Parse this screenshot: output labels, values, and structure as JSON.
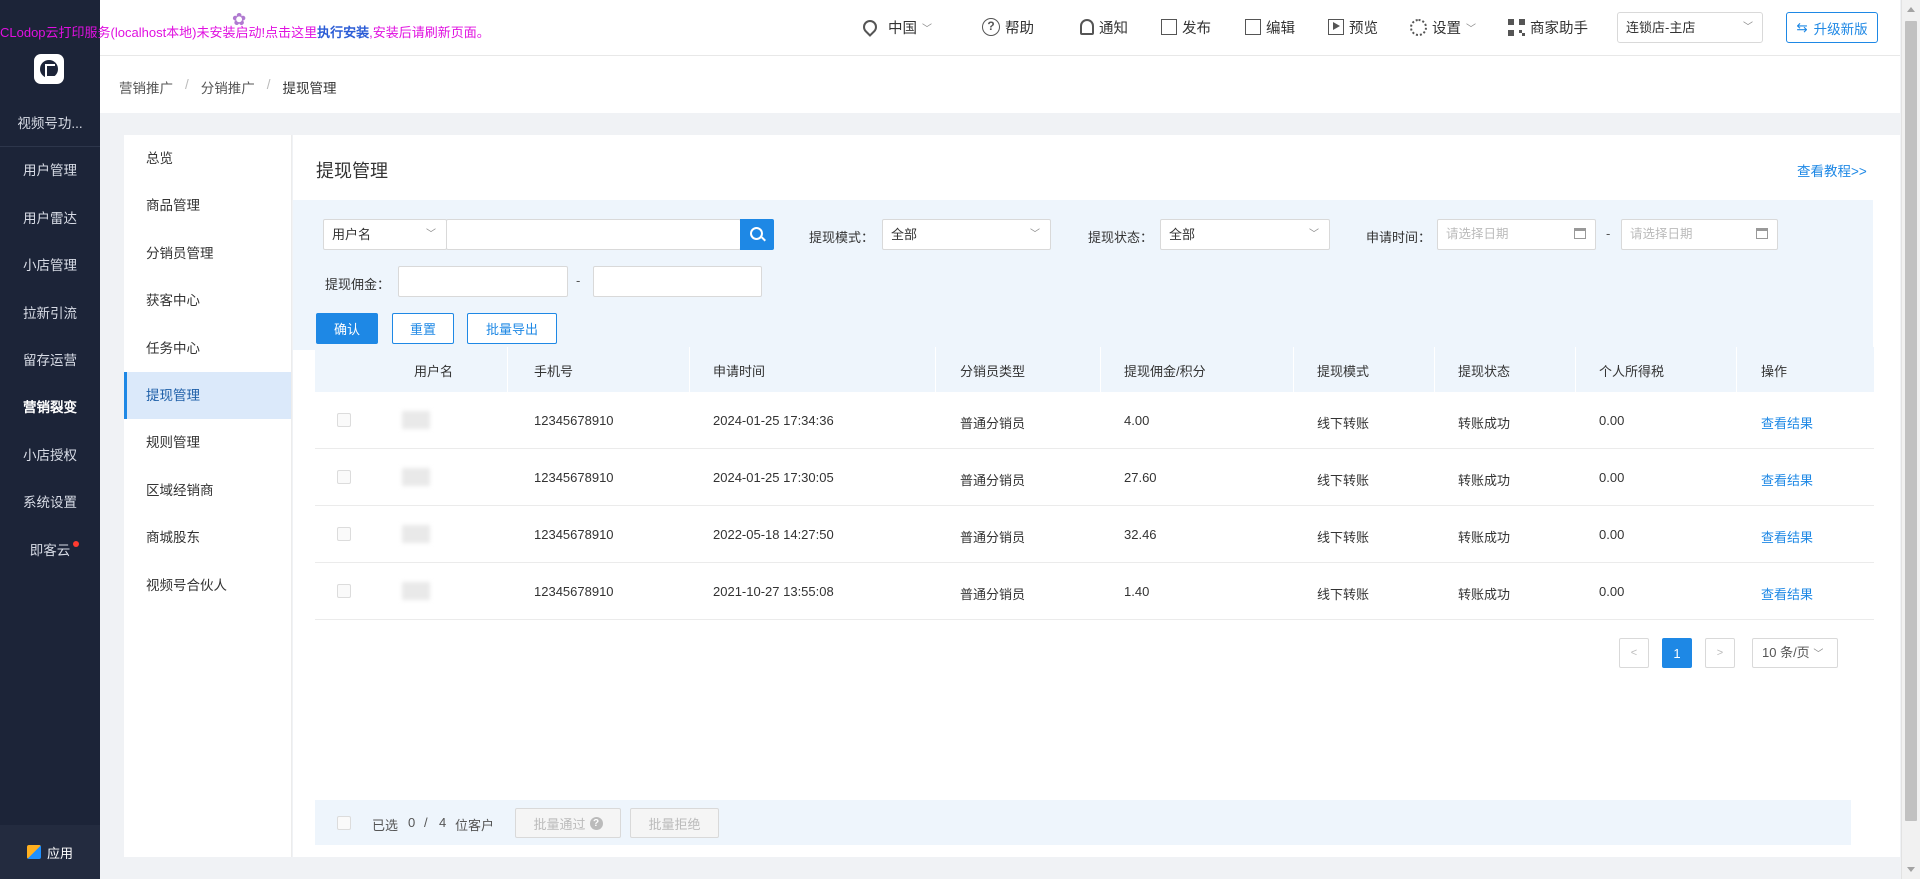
{
  "clodop_notice": {
    "prefix": "CLodop云打印服务(localhost本地)未安装启动!点击这里",
    "link": "执行安装",
    "suffix": ",安装后请刷新页面。"
  },
  "sidebar": {
    "items": [
      {
        "label": "视频号功..."
      },
      {
        "label": "用户管理"
      },
      {
        "label": "用户雷达"
      },
      {
        "label": "小店管理"
      },
      {
        "label": "拉新引流"
      },
      {
        "label": "留存运营"
      },
      {
        "label": "营销裂变"
      },
      {
        "label": "小店授权"
      },
      {
        "label": "系统设置"
      },
      {
        "label": "即客云"
      }
    ],
    "bottom_label": "应用"
  },
  "topbar": {
    "region": "中国",
    "help": "帮助",
    "notify": "通知",
    "publish": "发布",
    "edit": "编辑",
    "preview": "预览",
    "settings": "设置",
    "merchant_assistant": "商家助手",
    "store_select": "连锁店-主店",
    "upgrade": "升级新版"
  },
  "breadcrumb": [
    "营销推广",
    "分销推广",
    "提现管理"
  ],
  "submenu": [
    "总览",
    "商品管理",
    "分销员管理",
    "获客中心",
    "任务中心",
    "提现管理",
    "规则管理",
    "区域经销商",
    "商城股东",
    "视频号合伙人"
  ],
  "page": {
    "title": "提现管理",
    "tutorial_link": "查看教程>>"
  },
  "filters": {
    "search_field": "用户名",
    "withdraw_mode_label": "提现模式：",
    "withdraw_mode_value": "全部",
    "withdraw_status_label": "提现状态：",
    "withdraw_status_value": "全部",
    "apply_time_label": "申请时间：",
    "date_placeholder_start": "请选择日期",
    "date_placeholder_end": "请选择日期",
    "commission_label": "提现佣金：",
    "dash": "-",
    "confirm": "确认",
    "reset": "重置",
    "export": "批量导出"
  },
  "table": {
    "columns": [
      "用户名",
      "手机号",
      "申请时间",
      "分销员类型",
      "提现佣金/积分",
      "提现模式",
      "提现状态",
      "个人所得税",
      "操作"
    ],
    "rows": [
      {
        "phone": "12345678910",
        "time": "2024-01-25 17:34:36",
        "type": "普通分销员",
        "amount": "4.00",
        "mode": "线下转账",
        "status": "转账成功",
        "tax": "0.00",
        "action": "查看结果"
      },
      {
        "phone": "12345678910",
        "time": "2024-01-25 17:30:05",
        "type": "普通分销员",
        "amount": "27.60",
        "mode": "线下转账",
        "status": "转账成功",
        "tax": "0.00",
        "action": "查看结果"
      },
      {
        "phone": "12345678910",
        "time": "2022-05-18 14:27:50",
        "type": "普通分销员",
        "amount": "32.46",
        "mode": "线下转账",
        "status": "转账成功",
        "tax": "0.00",
        "action": "查看结果"
      },
      {
        "phone": "12345678910",
        "time": "2021-10-27 13:55:08",
        "type": "普通分销员",
        "amount": "1.40",
        "mode": "线下转账",
        "status": "转账成功",
        "tax": "0.00",
        "action": "查看结果"
      }
    ]
  },
  "pagination": {
    "prev": "<",
    "current": "1",
    "next": ">",
    "page_size": "10 条/页"
  },
  "footer": {
    "selected_label": "已选",
    "selected_count": "0",
    "sep": "/",
    "total": "4",
    "unit": "位客户",
    "approve": "批量通过",
    "reject": "批量拒绝"
  },
  "colors": {
    "accent": "#1e88e5",
    "sidebar_bg": "#1c2438",
    "notice": "#e010e0"
  }
}
